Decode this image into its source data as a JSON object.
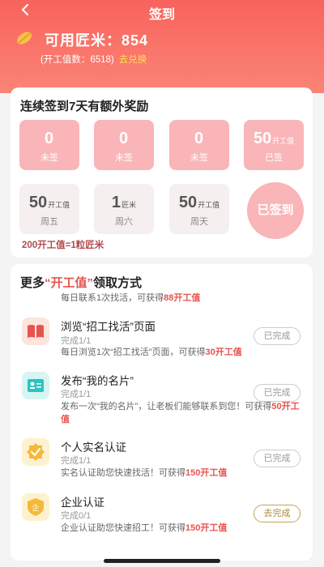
{
  "nav": {
    "title": "签到",
    "back_icon": "chevron-left-icon"
  },
  "account": {
    "points_text": "可用匠米：854",
    "sub_text": "(开工值数：6518)",
    "exchange_label": "去兑换",
    "icon": "wheat-icon"
  },
  "streak": {
    "title": "连续签到7天有额外奖励",
    "days": [
      {
        "value": "0",
        "unit": "",
        "label": "未签"
      },
      {
        "value": "0",
        "unit": "",
        "label": "未签"
      },
      {
        "value": "0",
        "unit": "",
        "label": "未签"
      },
      {
        "value": "50",
        "unit": "开工值",
        "label": "已签"
      },
      {
        "value": "50",
        "unit": "开工值",
        "label": "周五"
      },
      {
        "value": "1",
        "unit": "匠米",
        "label": "周六"
      },
      {
        "value": "50",
        "unit": "开工值",
        "label": "周天"
      }
    ],
    "signed_label": "已签到",
    "rate_text": "200开工值=1粒匠米"
  },
  "more": {
    "title_prefix": "更多",
    "title_highlight": "“开工值”",
    "title_suffix": "领取方式",
    "sub_prefix": "每日联系1次找活，可获得",
    "sub_reward": "88开工值",
    "tasks": [
      {
        "icon": "book-icon",
        "title": "浏览“招工找活”页面",
        "status": "完成1/1",
        "desc_prefix": "每日浏览1次“招工找活”页面，可获得",
        "reward": "30开工值",
        "button": "已完成"
      },
      {
        "icon": "business-card-icon",
        "title": "发布“我的名片”",
        "status": "完成1/1",
        "desc_prefix": "发布一次“我的名片”，让老板们能够联系到您！可获得",
        "reward": "50开工值",
        "button": "已完成"
      },
      {
        "icon": "verified-badge-icon",
        "title": "个人实名认证",
        "status": "完成1/1",
        "desc_prefix": "实名认证助您快速找活！可获得",
        "reward": "150开工值",
        "button": "已完成"
      },
      {
        "icon": "enterprise-shield-icon",
        "title": "企业认证",
        "status": "完成0/1",
        "desc_prefix": "企业认证助您快速招工！可获得",
        "reward": "150开工值",
        "button": "去完成"
      }
    ]
  },
  "colors": {
    "header": "#f8635c",
    "accent": "#e8534f",
    "pink_tile": "#f9b5b7",
    "gold": "#b08a3c"
  }
}
